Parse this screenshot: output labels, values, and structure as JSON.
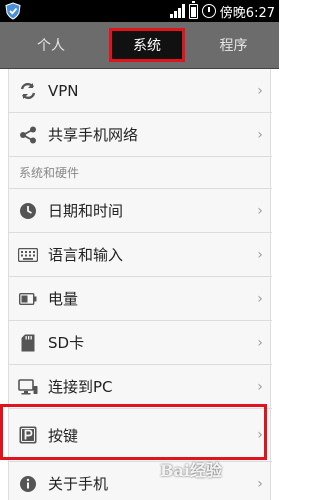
{
  "status_bar": {
    "time": "傍晚6:27"
  },
  "tabs": [
    {
      "label": "个人"
    },
    {
      "label": "系统"
    },
    {
      "label": "程序"
    }
  ],
  "rows_top": [
    {
      "label": "VPN",
      "icon": "sync-icon"
    },
    {
      "label": "共享手机网络",
      "icon": "share-icon"
    }
  ],
  "section": {
    "title": "系统和硬件"
  },
  "rows_system": [
    {
      "label": "日期和时间",
      "icon": "clock-icon"
    },
    {
      "label": "语言和输入",
      "icon": "keyboard-icon"
    },
    {
      "label": "电量",
      "icon": "battery-icon"
    },
    {
      "label": "SD卡",
      "icon": "sd-card-icon"
    },
    {
      "label": "连接到PC",
      "icon": "pc-icon"
    },
    {
      "label": "按键",
      "icon": "key-p-icon"
    },
    {
      "label": "关于手机",
      "icon": "info-icon"
    }
  ],
  "chevron": "›",
  "watermark": "Bai经验",
  "colors": {
    "highlight": "#e0141c",
    "tab_bar": "#6c6c6c",
    "list_bg": "#f7f7f7"
  }
}
